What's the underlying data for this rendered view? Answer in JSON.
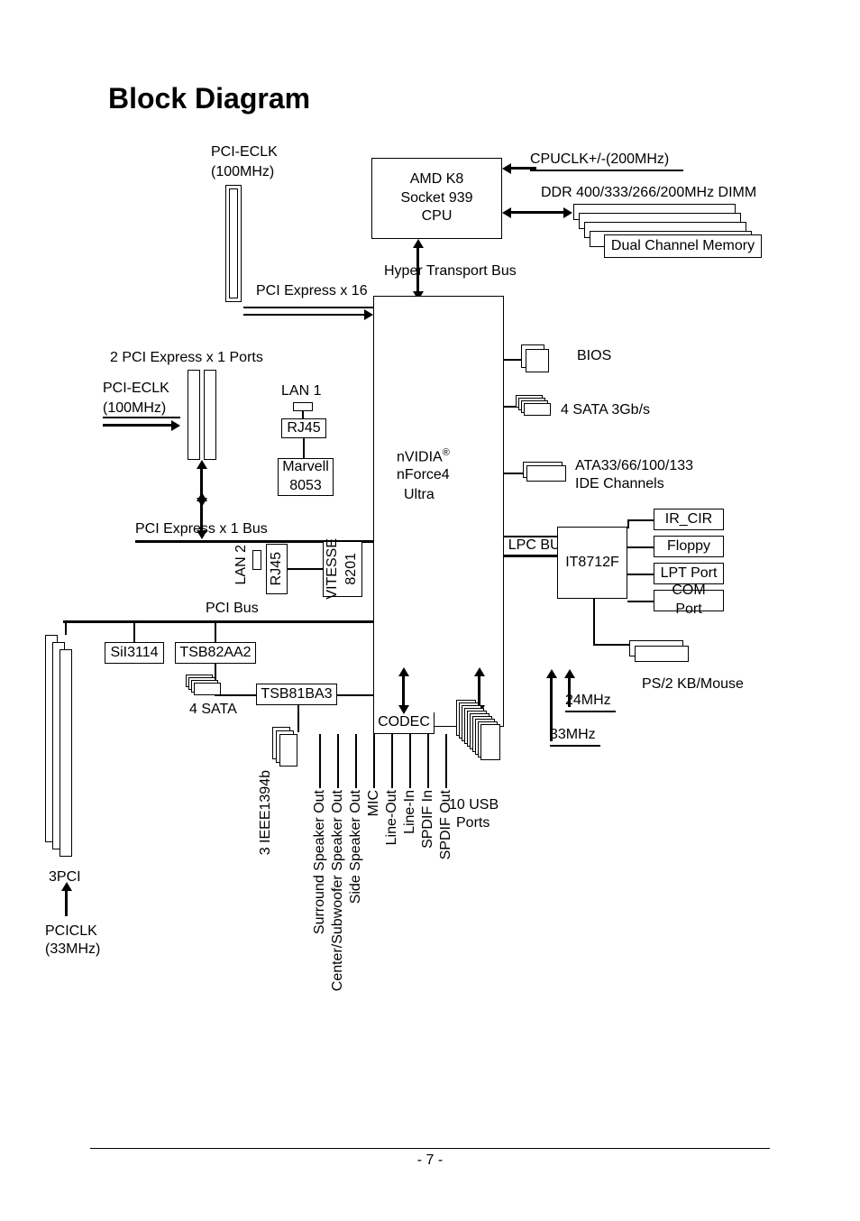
{
  "title": "Block Diagram",
  "cpu": {
    "line1": "AMD K8",
    "line2": "Socket 939",
    "line3": "CPU"
  },
  "labels": {
    "pci_eclk_top": "PCI-ECLK",
    "pci_eclk_top_freq": "(100MHz)",
    "cpuclk": "CPUCLK+/-(200MHz)",
    "ddr": "DDR 400/333/266/200MHz DIMM",
    "dual_channel": "Dual Channel Memory",
    "hyper_transport": "Hyper Transport Bus",
    "pci_express_x16": "PCI Express x 16",
    "two_pcie_x1": "2 PCI Express x 1 Ports",
    "pci_eclk_mid": "PCI-ECLK",
    "pci_eclk_mid_freq": "(100MHz)",
    "lan1": "LAN 1",
    "rj45_1": "RJ45",
    "marvell": "Marvell",
    "marvell_num": "8053",
    "chipset_l1": "nVIDIA",
    "chipset_reg": "®",
    "chipset_l2": "nForce4",
    "chipset_l3": "Ultra",
    "bios": "BIOS",
    "sata3g": "4 SATA 3Gb/s",
    "ata": "ATA33/66/100/133",
    "ide": "IDE Channels",
    "ir_cir": "IR_CIR",
    "lpc": "LPC BUS",
    "floppy": "Floppy",
    "it8712f": "IT8712F",
    "lpt": "LPT Port",
    "pcie_x1_bus": "PCI Express x 1 Bus",
    "lan2": "LAN 2",
    "rj45_2": "RJ45",
    "vitesse": "VITESSE",
    "vitesse_num": "8201",
    "com": "COM Port",
    "pci_bus": "PCI Bus",
    "sil3114": "SiI3114",
    "tsb82aa2": "TSB82AA2",
    "tsb81ba3": "TSB81BA3",
    "ps2": "PS/2 KB/Mouse",
    "mhz24": "24MHz",
    "mhz33": "33MHz",
    "codec": "CODEC",
    "four_sata": "4 SATA",
    "ieee1394": "3 IEEE1394b",
    "usb_count": "10 USB",
    "usb_ports": "Ports",
    "three_pci": "3PCI",
    "pciclk": "PCICLK",
    "pciclk_freq": "(33MHz)",
    "surround": "Surround Speaker Out",
    "center_sub": "Center/Subwoofer Speaker Out",
    "side": "Side Speaker Out",
    "mic": "MIC",
    "line_out": "Line-Out",
    "line_in": "Line-In",
    "spdif_in": "SPDIF In",
    "spdif_out": "SPDIF Out"
  },
  "page_number": "- 7 -"
}
